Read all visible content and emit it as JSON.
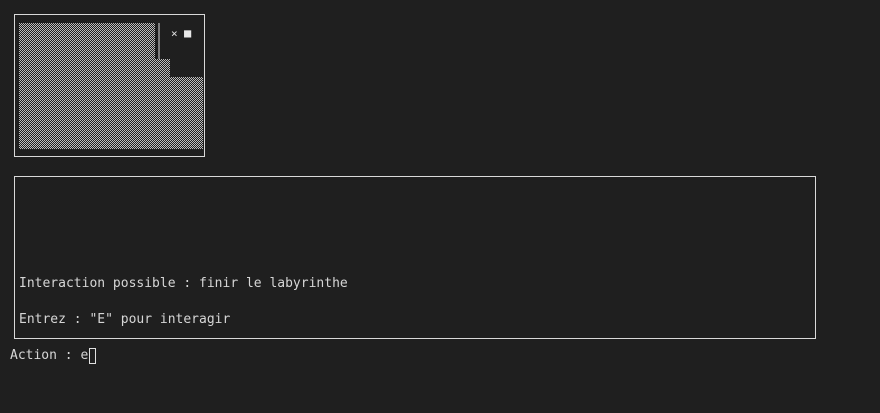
{
  "map": {
    "player_glyph": "×",
    "goal_glyph": "■",
    "wall_color": "#bdbdbd",
    "border_color": "#d9d9d9"
  },
  "messages": {
    "interaction": "Interaction possible : finir le labyrinthe",
    "instruction": "Entrez : \"E\" pour interagir"
  },
  "prompt": {
    "label": "Action : ",
    "input_value": "e"
  }
}
